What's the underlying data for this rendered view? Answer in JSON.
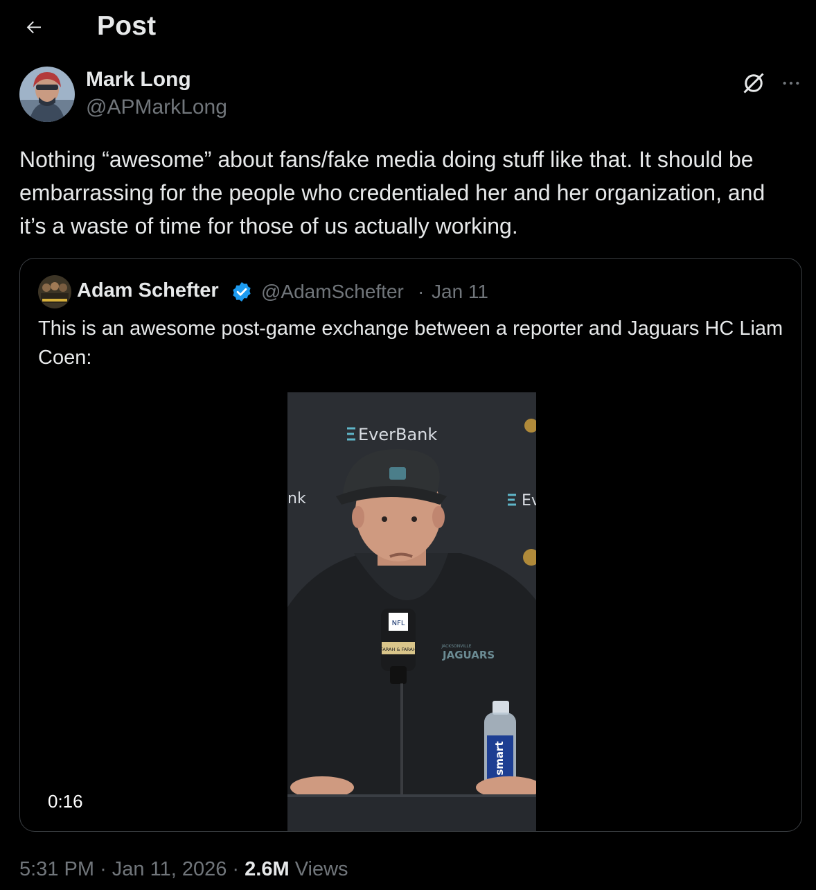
{
  "header": {
    "title": "Post"
  },
  "post": {
    "author_name": "Mark Long",
    "author_handle": "@APMarkLong",
    "text": "Nothing “awesome” about fans/fake media doing stuff like that. It should be embarrassing for the people who credentialed her and her organization, and it’s a waste of time for those of us actually working.",
    "time": "5:31 PM",
    "separator": "·",
    "date": "Jan 11, 2026",
    "views_count": "2.6M",
    "views_label": "Views"
  },
  "quoted_post": {
    "author_name": "Adam Schefter",
    "author_handle": "@AdamSchefter",
    "separator": "·",
    "date": "Jan 11",
    "text": "This is an awesome post-game exchange between a reporter and Jaguars HC Liam Coen:",
    "video": {
      "duration": "0:16",
      "backdrop_logo_text": "EverBank",
      "backdrop_partial_left": "nk",
      "backdrop_partial_right": "Ev",
      "mic_flag_top": "NFL",
      "mic_flag_bottom": "FARAH & FARAH",
      "shirt_text": "JAGUARS",
      "shirt_subtext": "JACKSONVILLE",
      "bottle_text": "smart"
    }
  },
  "colors": {
    "background": "#000000",
    "primary_text": "#e7e9ea",
    "secondary_text": "#71767b",
    "border": "#3a3e42",
    "verified": "#1d9bf0"
  },
  "icons": {
    "back": "arrow-left-icon",
    "grok": "grok-icon",
    "more": "more-icon",
    "verified": "verified-badge-icon"
  }
}
